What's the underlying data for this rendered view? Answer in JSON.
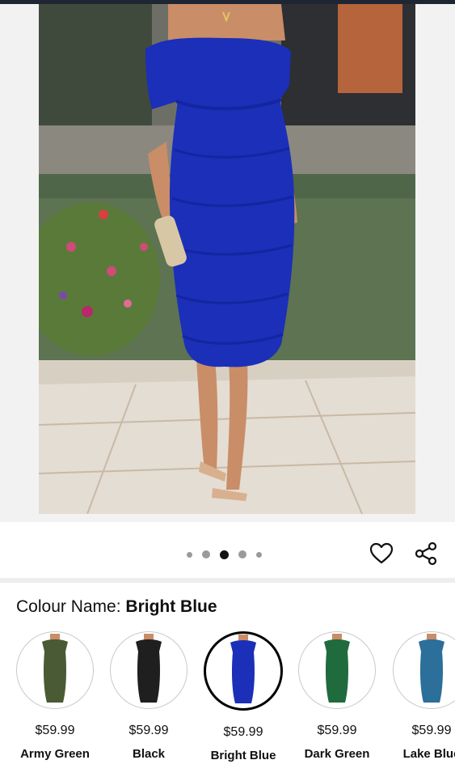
{
  "gallery": {
    "image_label": "Woman wearing bright blue off-shoulder ruched bodycon midi dress",
    "page_count": 5,
    "active_page": 3
  },
  "actions": {
    "wishlist_icon": "heart-icon",
    "share_icon": "share-icon"
  },
  "colour": {
    "label": "Colour Name:",
    "selected": "Bright Blue"
  },
  "swatches": [
    {
      "name": "Army Green",
      "price": "$59.99",
      "color": "#4a5a34"
    },
    {
      "name": "Black",
      "price": "$59.99",
      "color": "#1f1f1f"
    },
    {
      "name": "Bright Blue",
      "price": "$59.99",
      "color": "#1b2fb8",
      "selected": true
    },
    {
      "name": "Dark Green",
      "price": "$59.99",
      "color": "#1f6b3d"
    },
    {
      "name": "Lake Blue",
      "price": "$59.99",
      "color": "#2b6f9a"
    }
  ]
}
